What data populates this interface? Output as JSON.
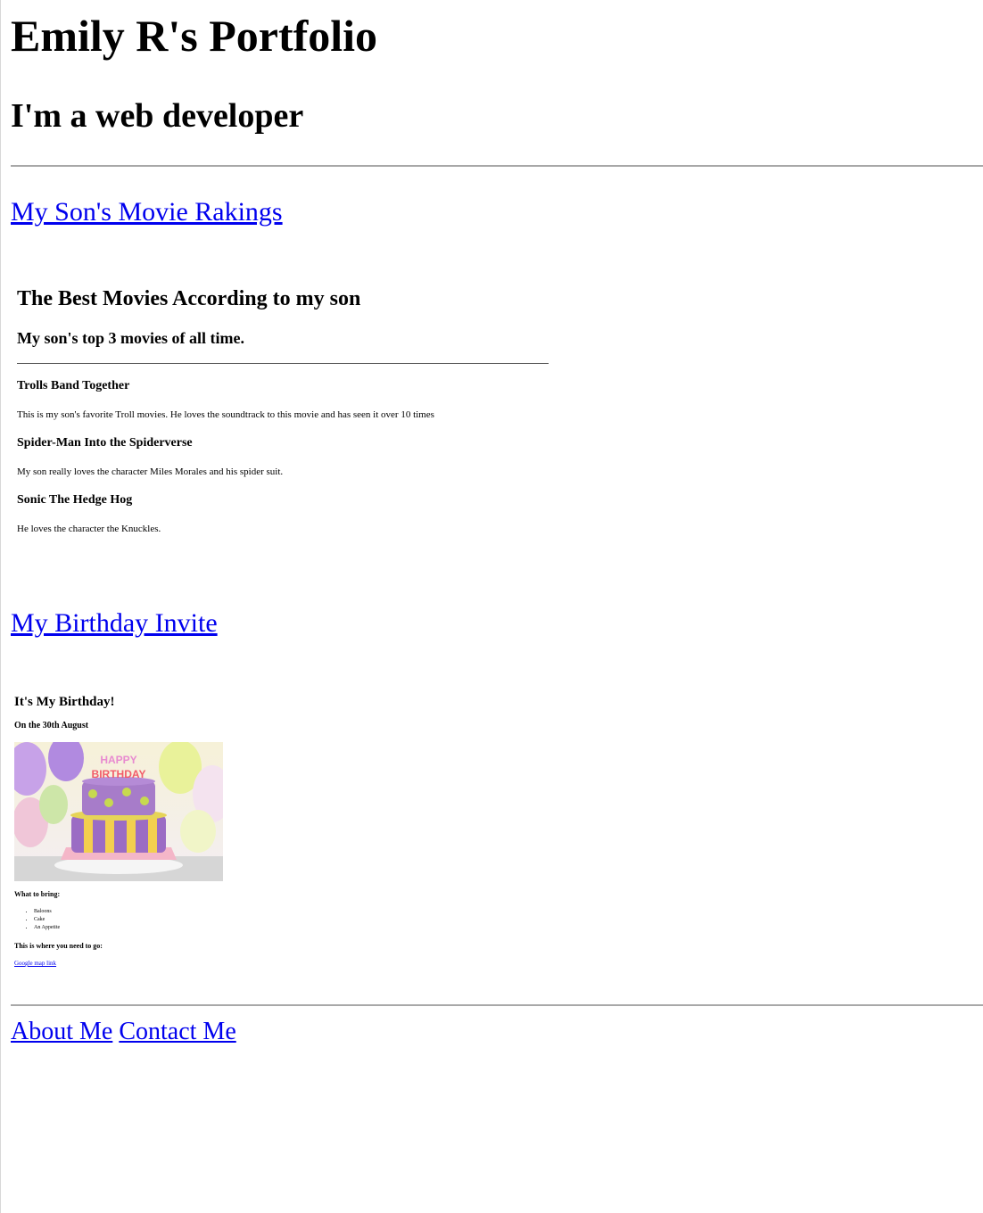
{
  "header": {
    "title": "Emily R's Portfolio",
    "subtitle": "I'm a web developer"
  },
  "projects": {
    "movies_link": "My Son's Movie Rakings",
    "birthday_link": "My Birthday Invite"
  },
  "movies_page": {
    "title": "The Best Movies According to my son",
    "subtitle": "My son's top 3 movies of all time.",
    "items": [
      {
        "name": "Trolls Band Together",
        "description": "This is my son's favorite Troll movies. He loves the soundtrack to this movie and has seen it over 10 times"
      },
      {
        "name": "Spider-Man Into the Spiderverse",
        "description": "My son really loves the character Miles Morales and his spider suit."
      },
      {
        "name": "Sonic The Hedge Hog",
        "description": "He loves the character the Knuckles."
      }
    ]
  },
  "invite_page": {
    "title": "It's My Birthday!",
    "date": "On the 30th August",
    "cake_sign_line1": "HAPPY",
    "cake_sign_line2": "BIRTHDAY",
    "bring_heading": "What to bring:",
    "bring_items": [
      "Baloons",
      "Cake",
      "An Appetite"
    ],
    "where_heading": "This is where you need to go:",
    "map_link": "Google map link"
  },
  "footer": {
    "about_link": "About Me",
    "contact_link": "Contact Me"
  },
  "colors": {
    "link": "#0000ee",
    "rule": "#a8a8a8"
  }
}
